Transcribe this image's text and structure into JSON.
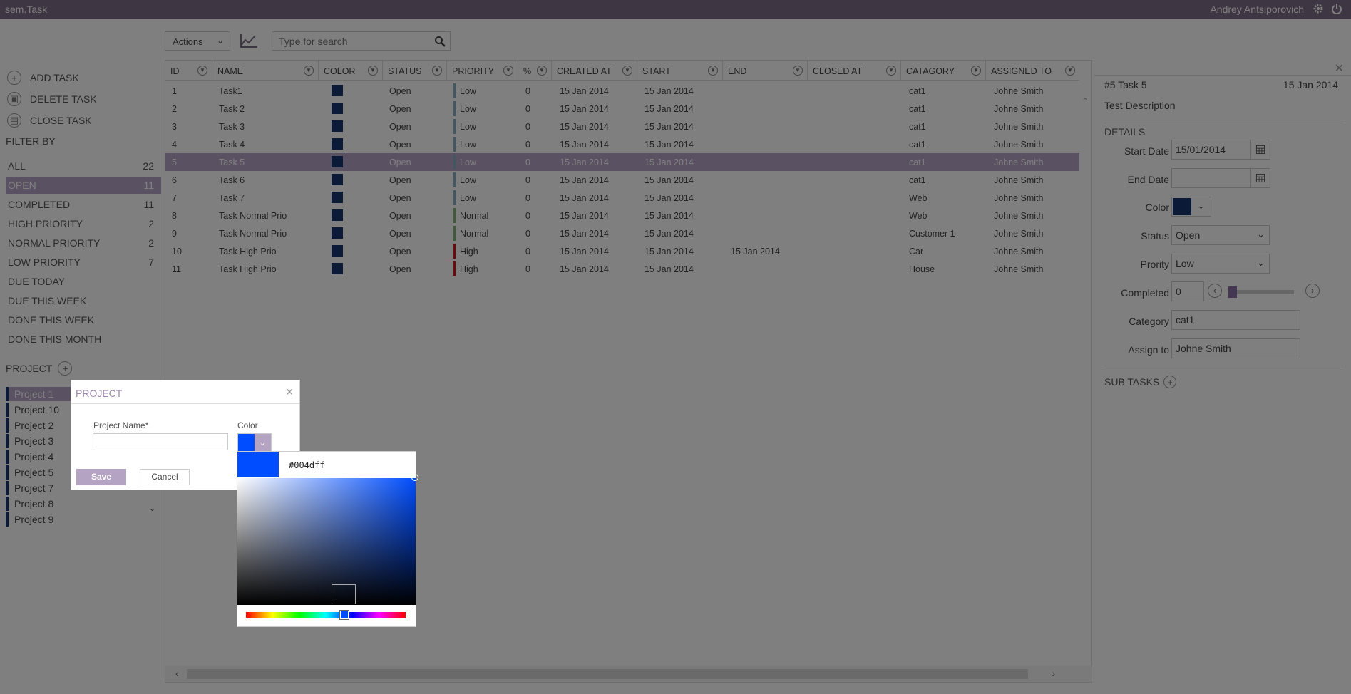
{
  "app": {
    "title": "sem.Task",
    "user": "Andrey Antsiporovich"
  },
  "sidebar": {
    "actions": [
      {
        "label": "ADD TASK",
        "icon": "plus-icon"
      },
      {
        "label": "DELETE TASK",
        "icon": "trash-icon"
      },
      {
        "label": "CLOSE TASK",
        "icon": "archive-icon"
      }
    ],
    "filter_title": "FILTER BY",
    "filters": [
      {
        "label": "ALL",
        "count": "22"
      },
      {
        "label": "OPEN",
        "count": "11"
      },
      {
        "label": "COMPLETED",
        "count": "11"
      },
      {
        "label": "HIGH PRIORITY",
        "count": "2"
      },
      {
        "label": "NORMAL PRIORITY",
        "count": "2"
      },
      {
        "label": "LOW PRIORITY",
        "count": "7"
      },
      {
        "label": "DUE TODAY",
        "count": ""
      },
      {
        "label": "DUE THIS WEEK",
        "count": ""
      },
      {
        "label": "DONE THIS WEEK",
        "count": ""
      },
      {
        "label": "DONE THIS MONTH",
        "count": ""
      }
    ],
    "project_title": "PROJECT",
    "projects": [
      "Project 1",
      "Project 10",
      "Project 2",
      "Project 3",
      "Project 4",
      "Project 5",
      "Project 7",
      "Project 8",
      "Project 9"
    ]
  },
  "toolbar": {
    "actions_label": "Actions",
    "search_placeholder": "Type for search"
  },
  "grid": {
    "columns": [
      "ID",
      "NAME",
      "COLOR",
      "STATUS",
      "PRIORITY",
      "%",
      "CREATED AT",
      "START",
      "END",
      "CLOSED AT",
      "CATAGORY",
      "ASSIGNED TO"
    ],
    "rows": [
      {
        "id": "1",
        "name": "Task1",
        "status": "Open",
        "priority": "Low",
        "pct": "0",
        "created": "15 Jan 2014",
        "start": "15 Jan 2014",
        "end": "",
        "closed": "",
        "category": "cat1",
        "assigned": "Johne Smith"
      },
      {
        "id": "2",
        "name": "Task 2",
        "status": "Open",
        "priority": "Low",
        "pct": "0",
        "created": "15 Jan 2014",
        "start": "15 Jan 2014",
        "end": "",
        "closed": "",
        "category": "cat1",
        "assigned": "Johne Smith"
      },
      {
        "id": "3",
        "name": "Task 3",
        "status": "Open",
        "priority": "Low",
        "pct": "0",
        "created": "15 Jan 2014",
        "start": "15 Jan 2014",
        "end": "",
        "closed": "",
        "category": "cat1",
        "assigned": "Johne Smith"
      },
      {
        "id": "4",
        "name": "Task 4",
        "status": "Open",
        "priority": "Low",
        "pct": "0",
        "created": "15 Jan 2014",
        "start": "15 Jan 2014",
        "end": "",
        "closed": "",
        "category": "cat1",
        "assigned": "Johne Smith"
      },
      {
        "id": "5",
        "name": "Task 5",
        "status": "Open",
        "priority": "Low",
        "pct": "0",
        "created": "15 Jan 2014",
        "start": "15 Jan 2014",
        "end": "",
        "closed": "",
        "category": "cat1",
        "assigned": "Johne Smith"
      },
      {
        "id": "6",
        "name": "Task 6",
        "status": "Open",
        "priority": "Low",
        "pct": "0",
        "created": "15 Jan 2014",
        "start": "15 Jan 2014",
        "end": "",
        "closed": "",
        "category": "cat1",
        "assigned": "Johne Smith"
      },
      {
        "id": "7",
        "name": "Task 7",
        "status": "Open",
        "priority": "Low",
        "pct": "0",
        "created": "15 Jan 2014",
        "start": "15 Jan 2014",
        "end": "",
        "closed": "",
        "category": "Web",
        "assigned": "Johne Smith"
      },
      {
        "id": "8",
        "name": "Task Normal Prio",
        "status": "Open",
        "priority": "Normal",
        "pct": "0",
        "created": "15 Jan 2014",
        "start": "15 Jan 2014",
        "end": "",
        "closed": "",
        "category": "Web",
        "assigned": "Johne Smith"
      },
      {
        "id": "9",
        "name": "Task Normal Prio",
        "status": "Open",
        "priority": "Normal",
        "pct": "0",
        "created": "15 Jan 2014",
        "start": "15 Jan 2014",
        "end": "",
        "closed": "",
        "category": "Customer 1",
        "assigned": "Johne Smith"
      },
      {
        "id": "10",
        "name": "Task High Prio",
        "status": "Open",
        "priority": "High",
        "pct": "0",
        "created": "15 Jan 2014",
        "start": "15 Jan 2014",
        "end": "15 Jan 2014",
        "closed": "",
        "category": "Car",
        "assigned": "Johne Smith"
      },
      {
        "id": "11",
        "name": "Task High Prio",
        "status": "Open",
        "priority": "High",
        "pct": "0",
        "created": "15 Jan 2014",
        "start": "15 Jan 2014",
        "end": "",
        "closed": "",
        "category": "House",
        "assigned": "Johne Smith"
      }
    ]
  },
  "details": {
    "title": "#5 Task 5",
    "date": "15 Jan 2014",
    "description": "Test Description",
    "section": "DETAILS",
    "labels": {
      "start": "Start Date",
      "end": "End Date",
      "color": "Color",
      "status": "Status",
      "priority": "Prority",
      "completed": "Completed",
      "category": "Category",
      "assign": "Assign to"
    },
    "start_date": "15/01/2014",
    "end_date": "",
    "status": "Open",
    "priority": "Low",
    "completed": "0",
    "category": "cat1",
    "assign": "Johne Smith",
    "subtasks": "SUB TASKS"
  },
  "dialog": {
    "title": "PROJECT",
    "name_label": "Project Name*",
    "name_value": "",
    "color_label": "Color",
    "save": "Save",
    "cancel": "Cancel"
  },
  "picker": {
    "hex": "#004dff"
  },
  "colors": {
    "accent": "#7e6c88",
    "selection": "#b5a3c4",
    "task_color": "#17356d",
    "picked": "#004dff",
    "low": "#7fb0c8",
    "normal": "#7ab86b",
    "high": "#d0161a"
  }
}
